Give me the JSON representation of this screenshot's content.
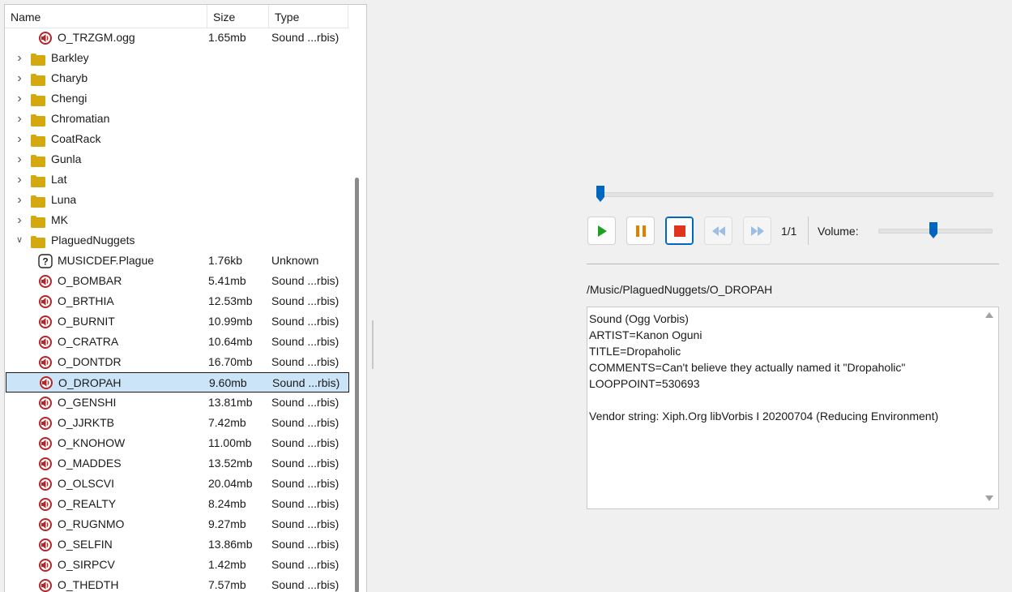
{
  "tree": {
    "columns": {
      "name": "Name",
      "size": "Size",
      "type": "Type"
    },
    "rows": [
      {
        "kind": "sound",
        "depth": 1,
        "name": "O_TRZGM.ogg",
        "size": "1.65mb",
        "type": "Sound ...rbis)"
      },
      {
        "kind": "folder",
        "depth": 0,
        "name": "Barkley",
        "expanded": false
      },
      {
        "kind": "folder",
        "depth": 0,
        "name": "Charyb",
        "expanded": false
      },
      {
        "kind": "folder",
        "depth": 0,
        "name": "Chengi",
        "expanded": false
      },
      {
        "kind": "folder",
        "depth": 0,
        "name": "Chromatian",
        "expanded": false
      },
      {
        "kind": "folder",
        "depth": 0,
        "name": "CoatRack",
        "expanded": false
      },
      {
        "kind": "folder",
        "depth": 0,
        "name": "Gunla",
        "expanded": false
      },
      {
        "kind": "folder",
        "depth": 0,
        "name": "Lat",
        "expanded": false
      },
      {
        "kind": "folder",
        "depth": 0,
        "name": "Luna",
        "expanded": false
      },
      {
        "kind": "folder",
        "depth": 0,
        "name": "MK",
        "expanded": false
      },
      {
        "kind": "folder",
        "depth": 0,
        "name": "PlaguedNuggets",
        "expanded": true
      },
      {
        "kind": "unknown",
        "depth": 1,
        "name": "MUSICDEF.Plague",
        "size": "1.76kb",
        "type": "Unknown"
      },
      {
        "kind": "sound",
        "depth": 1,
        "name": "O_BOMBAR",
        "size": "5.41mb",
        "type": "Sound ...rbis)"
      },
      {
        "kind": "sound",
        "depth": 1,
        "name": "O_BRTHIA",
        "size": "12.53mb",
        "type": "Sound ...rbis)"
      },
      {
        "kind": "sound",
        "depth": 1,
        "name": "O_BURNIT",
        "size": "10.99mb",
        "type": "Sound ...rbis)"
      },
      {
        "kind": "sound",
        "depth": 1,
        "name": "O_CRATRA",
        "size": "10.64mb",
        "type": "Sound ...rbis)"
      },
      {
        "kind": "sound",
        "depth": 1,
        "name": "O_DONTDR",
        "size": "16.70mb",
        "type": "Sound ...rbis)"
      },
      {
        "kind": "sound",
        "depth": 1,
        "name": "O_DROPAH",
        "size": "9.60mb",
        "type": "Sound ...rbis)",
        "selected": true
      },
      {
        "kind": "sound",
        "depth": 1,
        "name": "O_GENSHI",
        "size": "13.81mb",
        "type": "Sound ...rbis)"
      },
      {
        "kind": "sound",
        "depth": 1,
        "name": "O_JJRKTB",
        "size": "7.42mb",
        "type": "Sound ...rbis)"
      },
      {
        "kind": "sound",
        "depth": 1,
        "name": "O_KNOHOW",
        "size": "11.00mb",
        "type": "Sound ...rbis)"
      },
      {
        "kind": "sound",
        "depth": 1,
        "name": "O_MADDES",
        "size": "13.52mb",
        "type": "Sound ...rbis)"
      },
      {
        "kind": "sound",
        "depth": 1,
        "name": "O_OLSCVI",
        "size": "20.04mb",
        "type": "Sound ...rbis)"
      },
      {
        "kind": "sound",
        "depth": 1,
        "name": "O_REALTY",
        "size": "8.24mb",
        "type": "Sound ...rbis)"
      },
      {
        "kind": "sound",
        "depth": 1,
        "name": "O_RUGNMO",
        "size": "9.27mb",
        "type": "Sound ...rbis)"
      },
      {
        "kind": "sound",
        "depth": 1,
        "name": "O_SELFIN",
        "size": "13.86mb",
        "type": "Sound ...rbis)"
      },
      {
        "kind": "sound",
        "depth": 1,
        "name": "O_SIRPCV",
        "size": "1.42mb",
        "type": "Sound ...rbis)"
      },
      {
        "kind": "sound",
        "depth": 1,
        "name": "O_THEDTH",
        "size": "7.57mb",
        "type": "Sound ...rbis)"
      }
    ]
  },
  "player": {
    "seek_fraction": 0.0,
    "volume_fraction": 0.48,
    "track_count": "1/1",
    "volume_label": "Volume:",
    "buttons": [
      "play-icon",
      "pause-icon",
      "stop-icon",
      "rewind-icon",
      "fast-forward-icon"
    ]
  },
  "file_path": "/Music/PlaguedNuggets/O_DROPAH",
  "info": {
    "lines": [
      "Sound (Ogg Vorbis)",
      "ARTIST=Kanon Oguni",
      "TITLE=Dropaholic",
      "COMMENTS=Can't believe they actually named it \"Dropaholic\"",
      "LOOPPOINT=530693",
      "",
      "Vendor string: Xiph.Org libVorbis I 20200704 (Reducing Environment)"
    ]
  },
  "colors": {
    "accent": "#0067c0",
    "folder": "#d4a910",
    "sound_icon": "#b3262a",
    "play": "#1fa01f",
    "pause": "#e07f00",
    "stop": "#e0341c",
    "disabled": "#9cbde6",
    "selection": "#cce4f7"
  }
}
